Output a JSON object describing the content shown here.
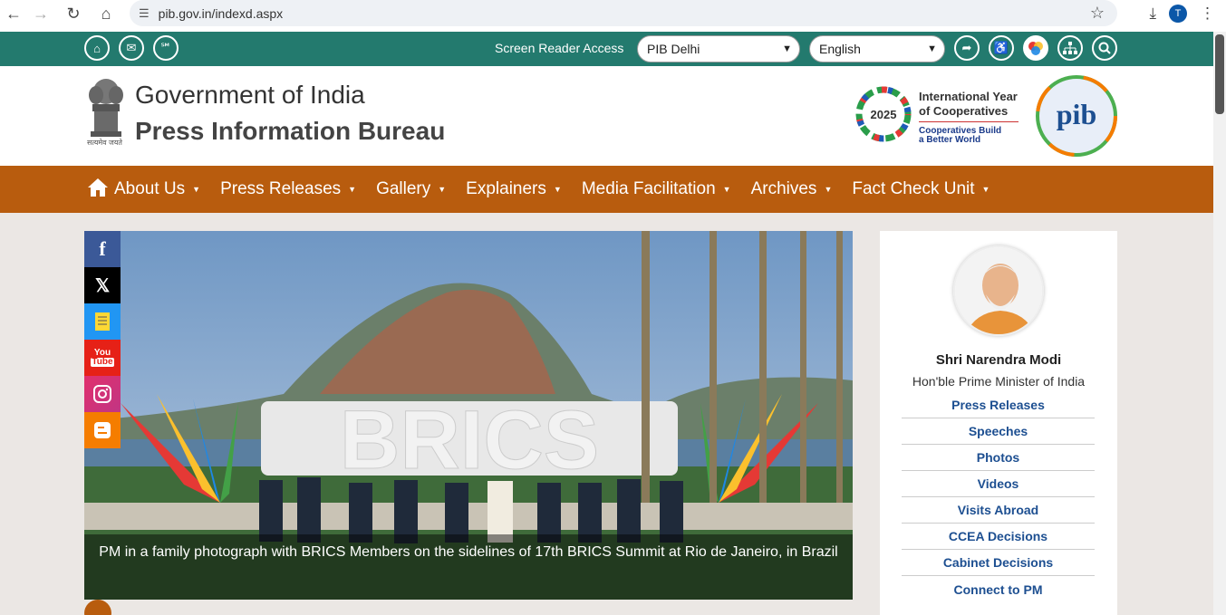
{
  "browser": {
    "url": "pib.gov.in/indexd.aspx",
    "profile_initial": "T"
  },
  "utility_bar": {
    "screen_reader_label": "Screen Reader Access",
    "region_select": "PIB Delhi",
    "language_select": "English",
    "left_icons": [
      "home-icon",
      "mail-icon",
      "rss-icon"
    ],
    "right_icons": [
      "share-icon",
      "accessibility-icon",
      "color-contrast-icon",
      "sitemap-icon",
      "search-icon"
    ]
  },
  "header": {
    "gov_title": "Government of India",
    "bureau_title": "Press Information Bureau",
    "emblem_caption": "सत्यमेव जयते",
    "iyc": {
      "year": "2025",
      "line1": "International Year",
      "line2": "of Cooperatives",
      "sub1": "Cooperatives Build",
      "sub2": "a Better World"
    },
    "pib_logo_text": "pib"
  },
  "nav": {
    "items": [
      {
        "label": "About Us"
      },
      {
        "label": "Press Releases"
      },
      {
        "label": "Gallery"
      },
      {
        "label": "Explainers"
      },
      {
        "label": "Media Facilitation"
      },
      {
        "label": "Archives"
      },
      {
        "label": "Fact Check Unit"
      }
    ]
  },
  "slider": {
    "sign_text": "BRICS",
    "caption": "PM in a family photograph with BRICS Members on the sidelines of 17th BRICS Summit at Rio de Janeiro, in Brazil"
  },
  "social": [
    "facebook-icon",
    "x-icon",
    "koo-icon",
    "youtube-icon",
    "instagram-icon",
    "blogger-icon"
  ],
  "pm_panel": {
    "name": "Shri Narendra Modi",
    "role": "Hon'ble Prime Minister of India",
    "links": [
      "Press Releases",
      "Speeches",
      "Photos",
      "Videos",
      "Visits Abroad",
      "CCEA Decisions",
      "Cabinet Decisions",
      "Connect to PM"
    ]
  },
  "colors": {
    "utility_green": "#237a6e",
    "nav_orange": "#b85c0e",
    "link_blue": "#1d4f91"
  }
}
